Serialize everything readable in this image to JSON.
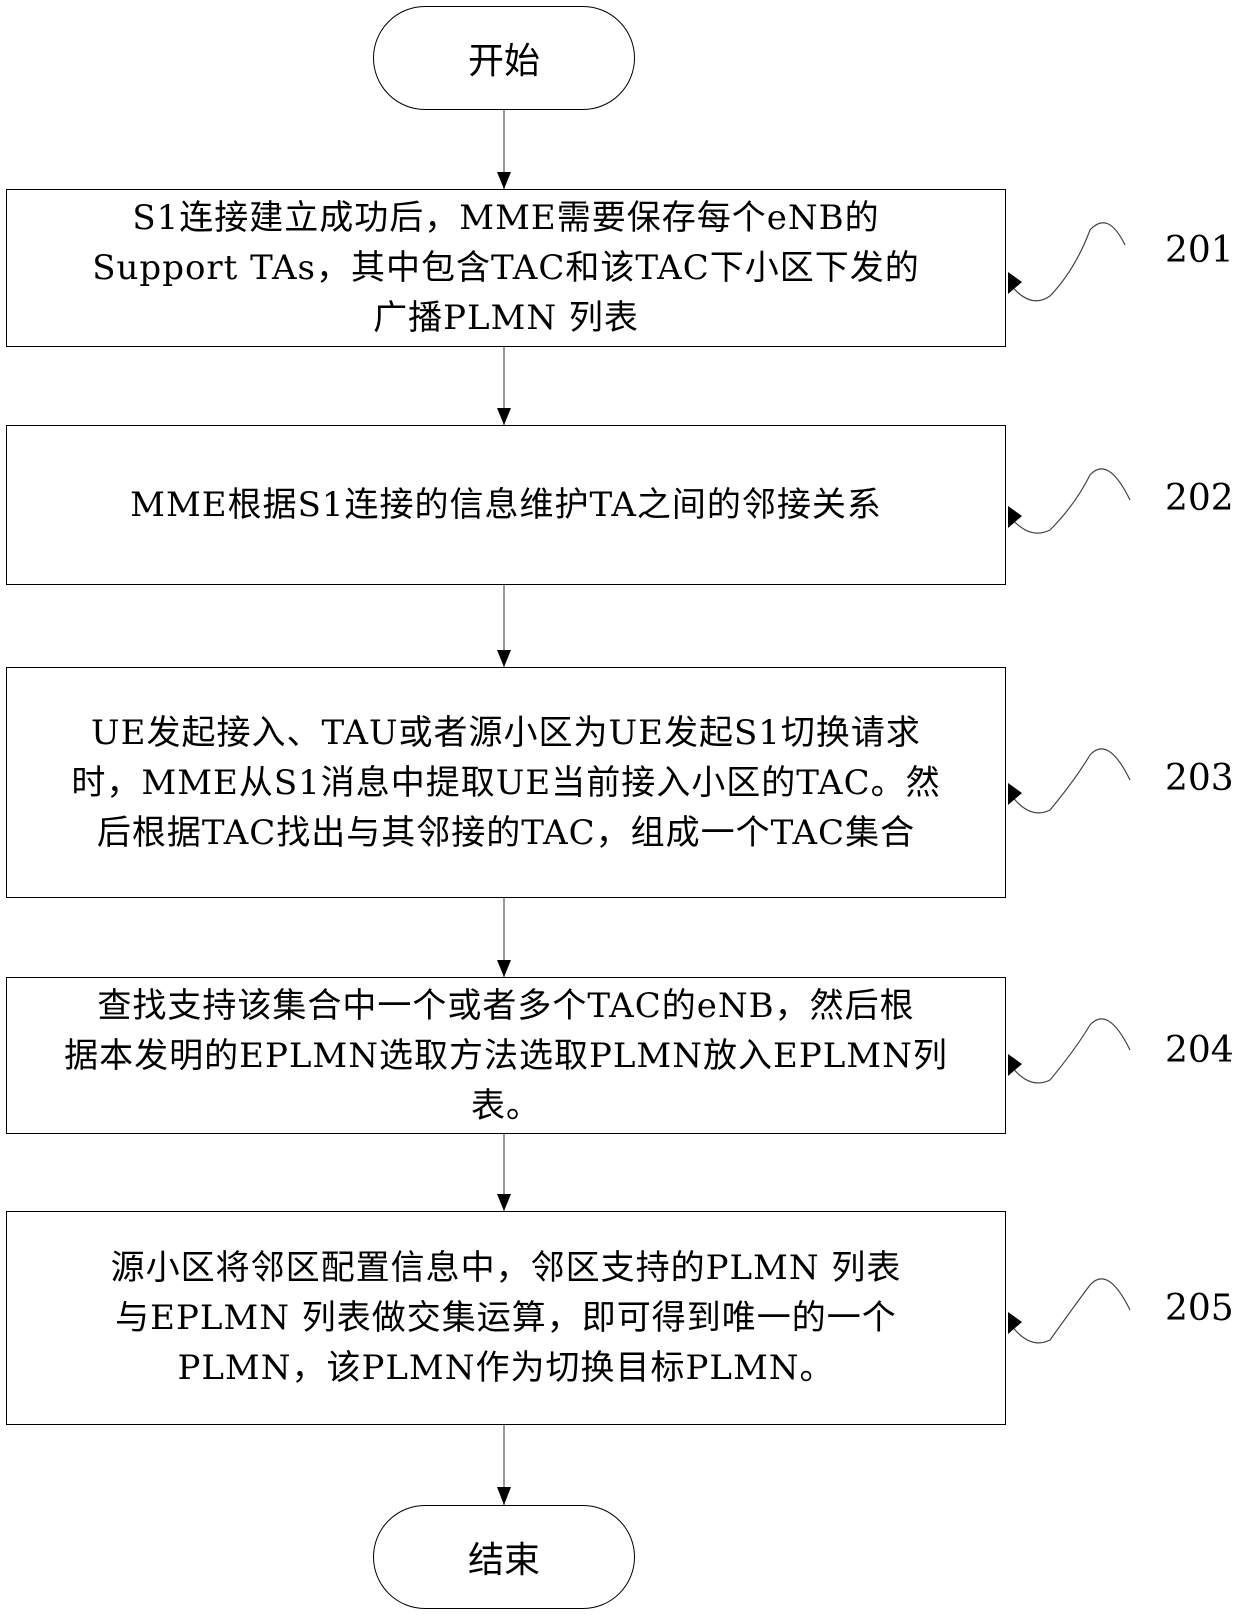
{
  "flowchart": {
    "start": {
      "label": "开始"
    },
    "end": {
      "label": "结束"
    },
    "steps": [
      {
        "ref": "201",
        "lines": [
          "S1连接建立成功后，MME需要保存每个eNB的",
          "Support TAs，其中包含TAC和该TAC下小区下发的",
          "广播PLMN 列表"
        ]
      },
      {
        "ref": "202",
        "lines": [
          "MME根据S1连接的信息维护TA之间的邻接关系"
        ]
      },
      {
        "ref": "203",
        "lines": [
          "UE发起接入、TAU或者源小区为UE发起S1切换请求",
          "时，MME从S1消息中提取UE当前接入小区的TAC。然",
          "后根据TAC找出与其邻接的TAC，组成一个TAC集合"
        ]
      },
      {
        "ref": "204",
        "lines": [
          "查找支持该集合中一个或者多个TAC的eNB，然后根",
          "据本发明的EPLMN选取方法选取PLMN放入EPLMN列",
          "表。"
        ]
      },
      {
        "ref": "205",
        "lines": [
          "源小区将邻区配置信息中，邻区支持的PLMN 列表",
          "与EPLMN 列表做交集运算，即可得到唯一的一个",
          "PLMN，该PLMN作为切换目标PLMN。"
        ]
      }
    ]
  }
}
